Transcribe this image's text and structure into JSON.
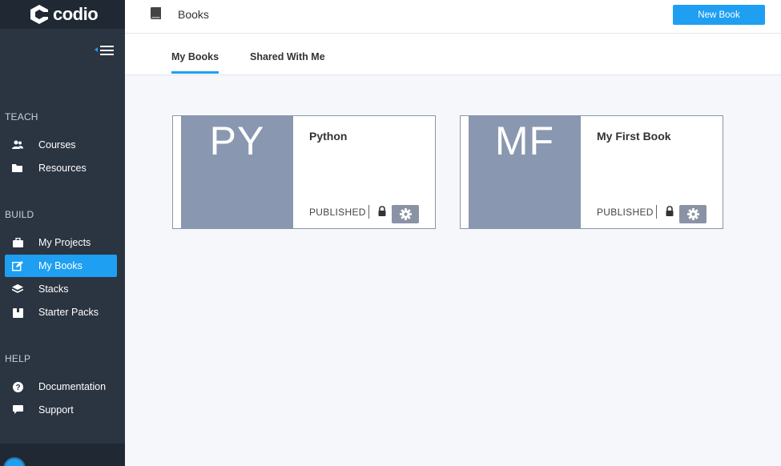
{
  "app": {
    "logo_text": "codio"
  },
  "sidebar": {
    "sections": [
      {
        "heading": "TEACH",
        "items": [
          {
            "label": "Courses",
            "icon": "users-icon"
          },
          {
            "label": "Resources",
            "icon": "folder-icon"
          }
        ]
      },
      {
        "heading": "BUILD",
        "items": [
          {
            "label": "My Projects",
            "icon": "briefcase-icon"
          },
          {
            "label": "My Books",
            "icon": "edit-icon",
            "active": true
          },
          {
            "label": "Stacks",
            "icon": "layers-icon"
          },
          {
            "label": "Starter Packs",
            "icon": "box-icon"
          }
        ]
      },
      {
        "heading": "HELP",
        "items": [
          {
            "label": "Documentation",
            "icon": "question-icon"
          },
          {
            "label": "Support",
            "icon": "chat-icon"
          }
        ]
      }
    ]
  },
  "header": {
    "title": "Books",
    "new_book_label": "New Book"
  },
  "tabs": [
    {
      "label": "My Books",
      "active": true
    },
    {
      "label": "Shared With Me",
      "active": false
    }
  ],
  "books": [
    {
      "initials": "PY",
      "title": "Python",
      "status": "PUBLISHED"
    },
    {
      "initials": "MF",
      "title": "My First Book",
      "status": "PUBLISHED"
    }
  ],
  "colors": {
    "accent": "#1e9ff2",
    "sidebar_bg": "#2b3441",
    "thumb_bg": "#8a97b0"
  }
}
